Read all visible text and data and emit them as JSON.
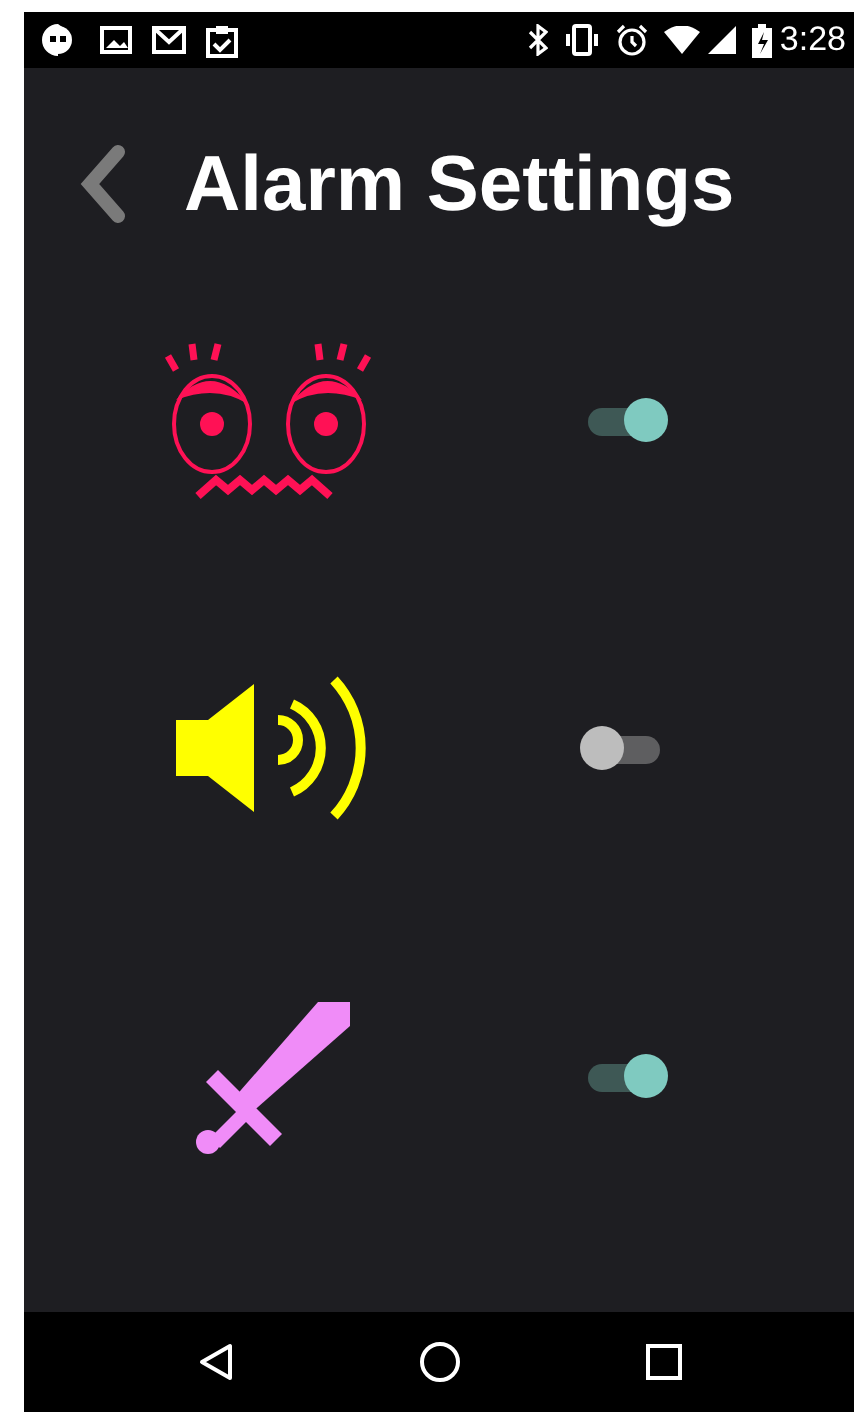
{
  "status_bar": {
    "time": "3:28"
  },
  "header": {
    "title": "Alarm Settings"
  },
  "settings": [
    {
      "kind": "face",
      "on": true
    },
    {
      "kind": "sound",
      "on": false
    },
    {
      "kind": "sword",
      "on": true
    }
  ]
}
